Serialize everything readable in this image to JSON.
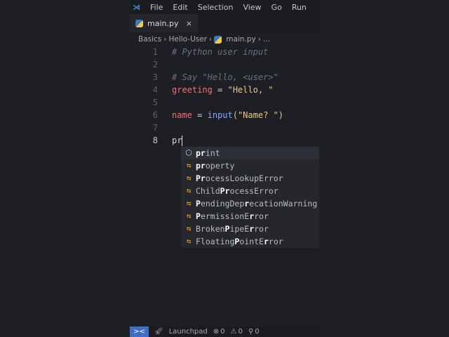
{
  "menu": {
    "items": [
      "File",
      "Edit",
      "Selection",
      "View",
      "Go",
      "Run"
    ],
    "more": "···"
  },
  "tab": {
    "label": "main.py",
    "close": "×"
  },
  "breadcrumb": [
    "Basics",
    "Hello-User",
    "main.py",
    "..."
  ],
  "lines": [
    {
      "n": "1",
      "text": "# Python user input"
    },
    {
      "n": "2",
      "text": ""
    },
    {
      "n": "3",
      "text": "# Say \"Hello, <user>\""
    },
    {
      "n": "4",
      "var": "greeting",
      "op": " = ",
      "str": "\"Hello, \""
    },
    {
      "n": "5",
      "text": ""
    },
    {
      "n": "6",
      "var": "name",
      "op": " = ",
      "fn": "input",
      "str": "(\"Name? \")"
    },
    {
      "n": "7",
      "text": ""
    },
    {
      "n": "8",
      "typed": "pr"
    }
  ],
  "suggestions": [
    {
      "icon": "cube",
      "parts": [
        {
          "t": "pr",
          "b": true
        },
        {
          "t": "int"
        }
      ]
    },
    {
      "icon": "class",
      "parts": [
        {
          "t": "pr",
          "b": true
        },
        {
          "t": "operty"
        }
      ]
    },
    {
      "icon": "class",
      "parts": [
        {
          "t": "Pr",
          "b": true
        },
        {
          "t": "ocessLookupError"
        }
      ]
    },
    {
      "icon": "class",
      "parts": [
        {
          "t": "Child"
        },
        {
          "t": "Pr",
          "b": true
        },
        {
          "t": "ocessError"
        }
      ]
    },
    {
      "icon": "class",
      "parts": [
        {
          "t": "P",
          "b": true
        },
        {
          "t": "endingDep"
        },
        {
          "t": "r",
          "b": true
        },
        {
          "t": "ecationWarning"
        }
      ]
    },
    {
      "icon": "class",
      "parts": [
        {
          "t": "P",
          "b": true
        },
        {
          "t": "ermissionE"
        },
        {
          "t": "r",
          "b": true
        },
        {
          "t": "ror"
        }
      ]
    },
    {
      "icon": "class",
      "parts": [
        {
          "t": "Broken"
        },
        {
          "t": "P",
          "b": true
        },
        {
          "t": "ipeE"
        },
        {
          "t": "r",
          "b": true
        },
        {
          "t": "ror"
        }
      ]
    },
    {
      "icon": "class",
      "parts": [
        {
          "t": "Floating"
        },
        {
          "t": "P",
          "b": true
        },
        {
          "t": "ointE"
        },
        {
          "t": "r",
          "b": true
        },
        {
          "t": "ror"
        }
      ]
    }
  ],
  "status": {
    "remote": "><",
    "launchpad": "Launchpad",
    "errors": "0",
    "warnings": "0",
    "ports": "0"
  }
}
